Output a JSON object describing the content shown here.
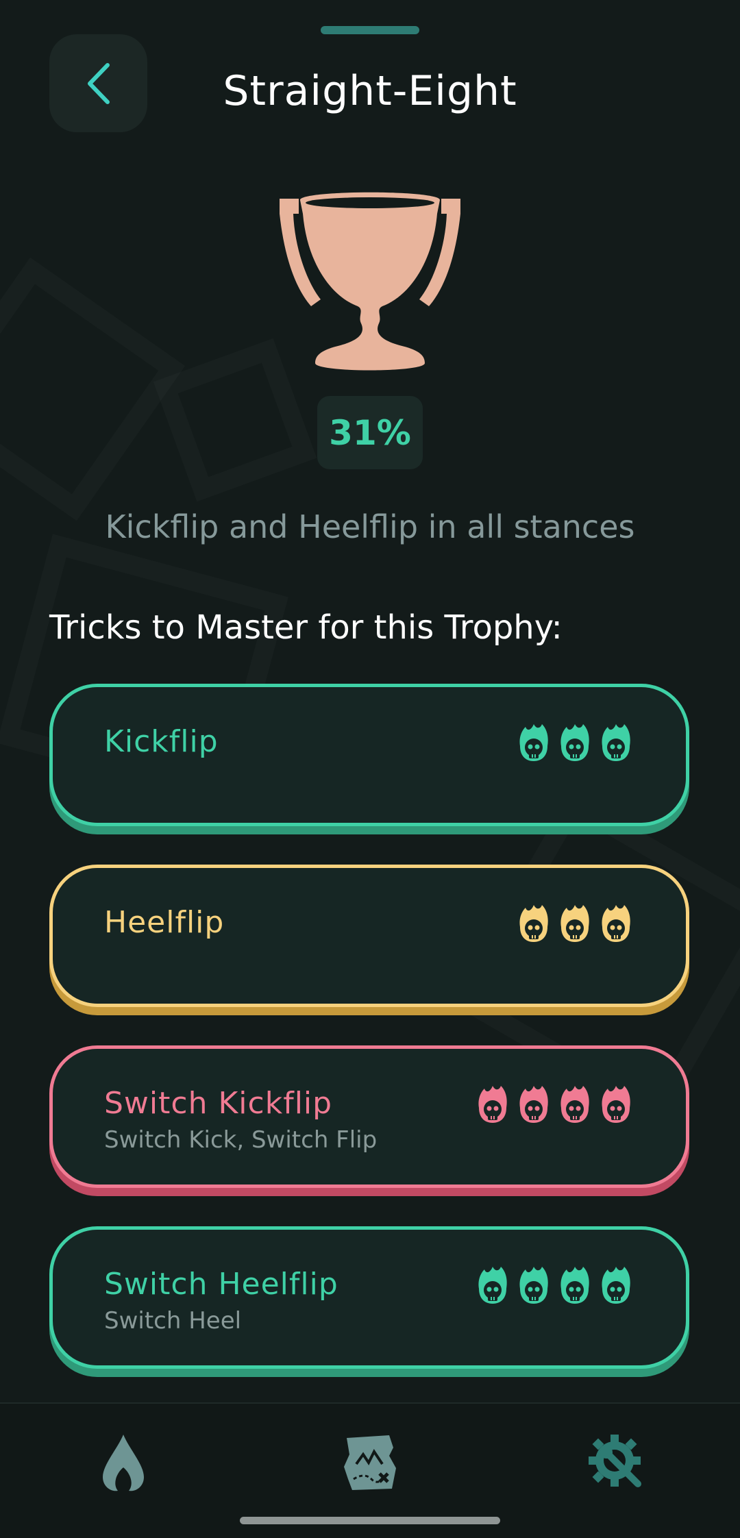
{
  "header": {
    "title": "Straight-Eight"
  },
  "trophy": {
    "percent": "31%",
    "description": "Kickflip and Heelflip in all stances"
  },
  "section": {
    "heading": "Tricks to Master for this Trophy:"
  },
  "colors": {
    "green": "#3fd1a6",
    "yellow": "#f7d27e",
    "pink": "#f07b93",
    "trophy": "#e8b49c"
  },
  "tricks": [
    {
      "name": "Kickflip",
      "subtitle": "",
      "color": "green",
      "skull_icon": "flaming-skull-icon",
      "skulls": 3
    },
    {
      "name": "Heelflip",
      "subtitle": "",
      "color": "yellow",
      "skull_icon": "flaming-skull-icon",
      "skulls": 3
    },
    {
      "name": "Switch Kickflip",
      "subtitle": "Switch Kick, Switch Flip",
      "color": "pink",
      "skull_icon": "flaming-skull-icon",
      "skulls": 4
    },
    {
      "name": "Switch Heelflip",
      "subtitle": "Switch Heel",
      "color": "green",
      "skull_icon": "flaming-skull-icon",
      "skulls": 4
    }
  ],
  "nav": {
    "items": [
      {
        "icon": "flame-drop-icon"
      },
      {
        "icon": "treasure-map-icon"
      },
      {
        "icon": "gear-wrench-icon"
      }
    ]
  }
}
